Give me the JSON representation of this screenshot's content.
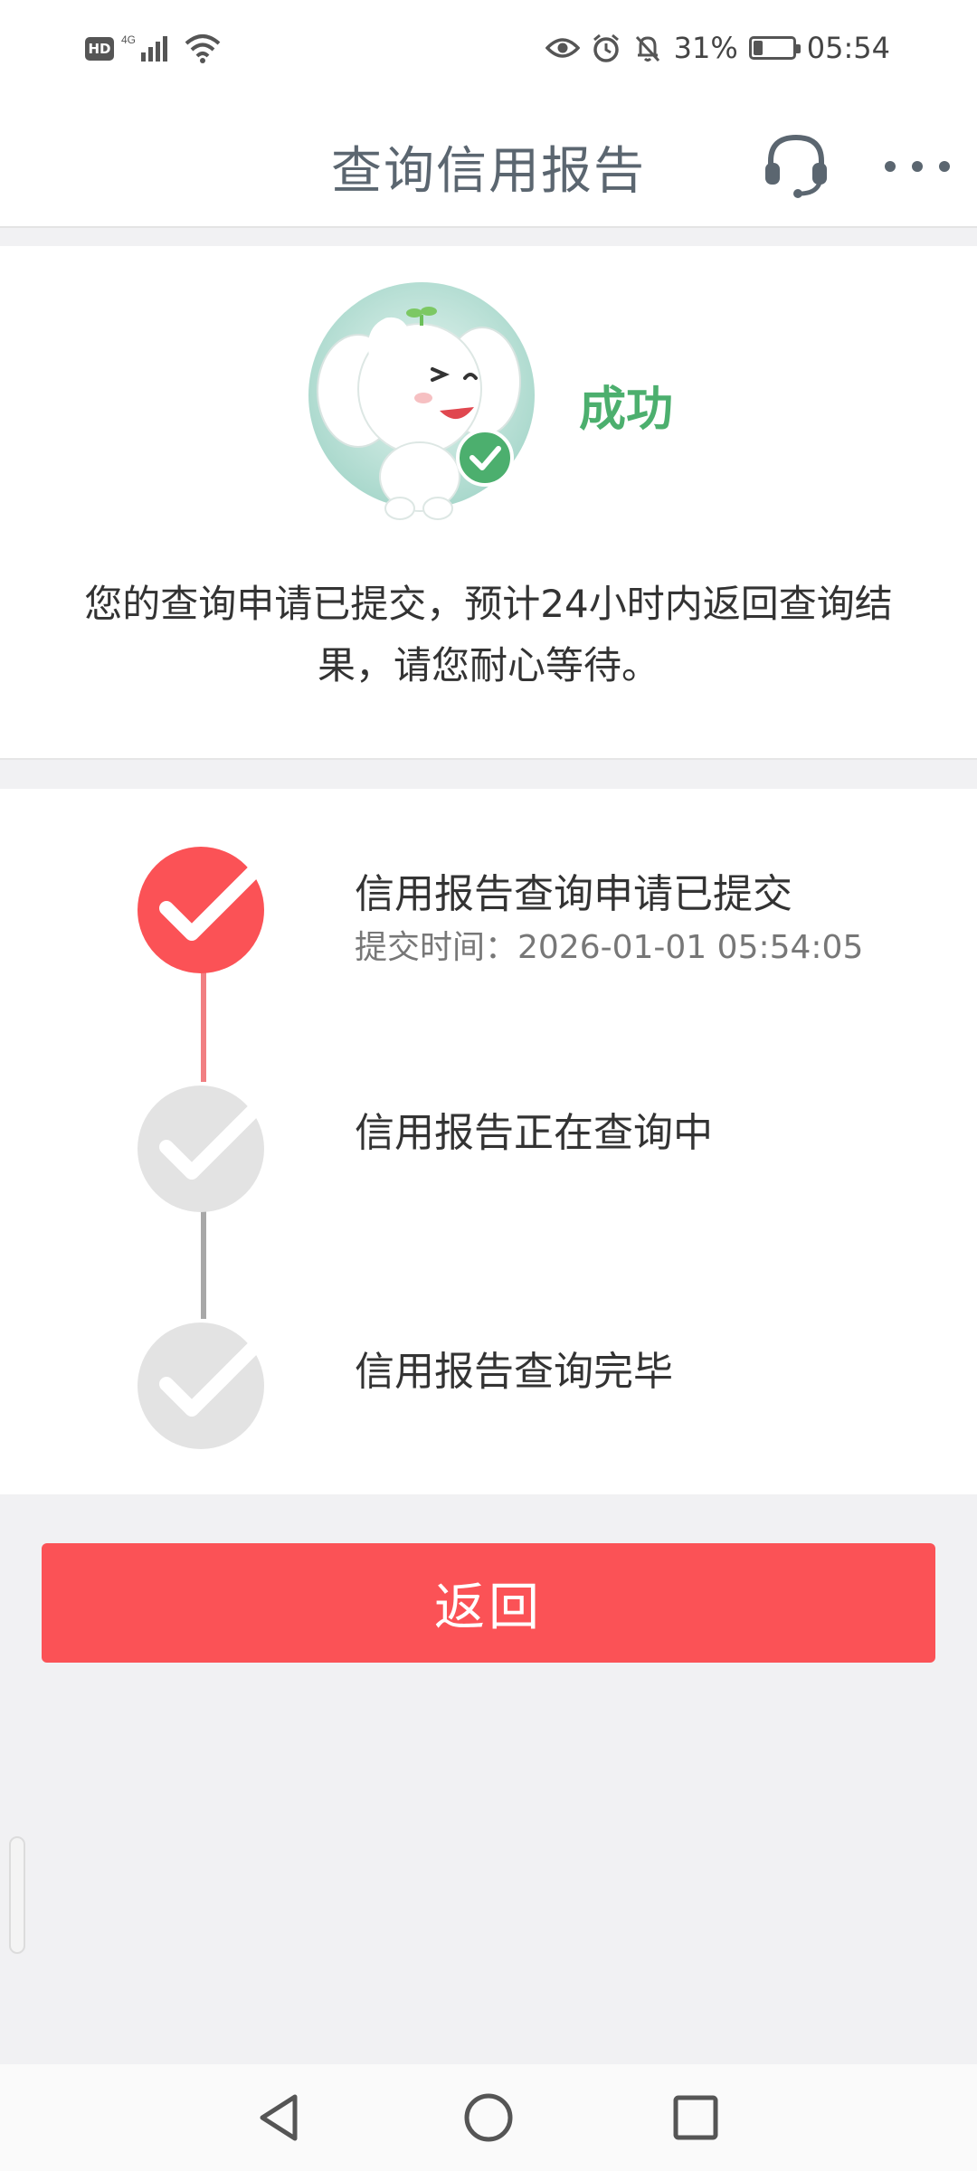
{
  "status_bar": {
    "hd": "HD",
    "network": "4G",
    "battery_percent": "31%",
    "battery_level": 0.31,
    "time": "05:54"
  },
  "nav": {
    "title": "查询信用报告",
    "headset_icon": "headset-icon",
    "more_icon": "more-icon"
  },
  "result": {
    "status": "成功",
    "message": "您的查询申请已提交，预计24小时内返回查询结果，请您耐心等待。"
  },
  "steps": [
    {
      "title": "信用报告查询申请已提交",
      "subtitle": "提交时间：2026-01-01 05:54:05",
      "done": true
    },
    {
      "title": "信用报告正在查询中",
      "subtitle": "",
      "done": false
    },
    {
      "title": "信用报告查询完毕",
      "subtitle": "",
      "done": false
    }
  ],
  "actions": {
    "back_label": "返回"
  },
  "colors": {
    "accent": "#fb5256",
    "success": "#4caf6e",
    "inactive": "#e3e3e3"
  }
}
